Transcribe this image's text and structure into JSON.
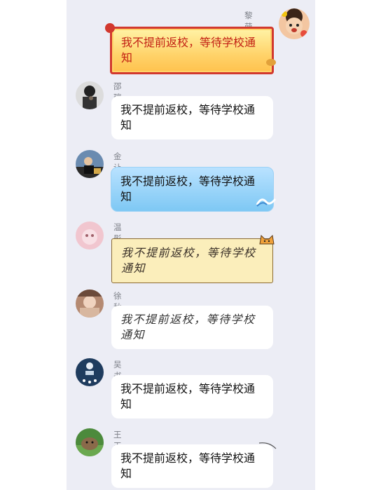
{
  "messages": [
    {
      "sender": "黎萌洁",
      "text": "我不提前返校，等待学校通知",
      "style": "red-frame",
      "side": "right"
    },
    {
      "sender": "邵瑄",
      "text": "我不提前返校，等待学校通知",
      "style": "plain",
      "side": "left"
    },
    {
      "sender": "金让",
      "text": "我不提前返校，等待学校通知",
      "style": "blue-wave",
      "side": "left"
    },
    {
      "sender": "温彤",
      "text": "我不提前返校，等待学校通知",
      "style": "scroll-cat",
      "side": "left"
    },
    {
      "sender": "徐秋怡",
      "text": "我不提前返校，等待学校通知",
      "style": "plain-script",
      "side": "left"
    },
    {
      "sender": "吴书杰",
      "text": "我不提前返校，等待学校通知",
      "style": "plain",
      "side": "left"
    },
    {
      "sender": "王玉东",
      "text": "我不提前返校，等待学校通知",
      "style": "plain",
      "side": "left"
    }
  ],
  "colors": {
    "panel_bg": "#ecedf5",
    "sender_text": "#7d8088",
    "red_frame": "#d2382e",
    "blue_bubble": "#8fd0f7"
  }
}
